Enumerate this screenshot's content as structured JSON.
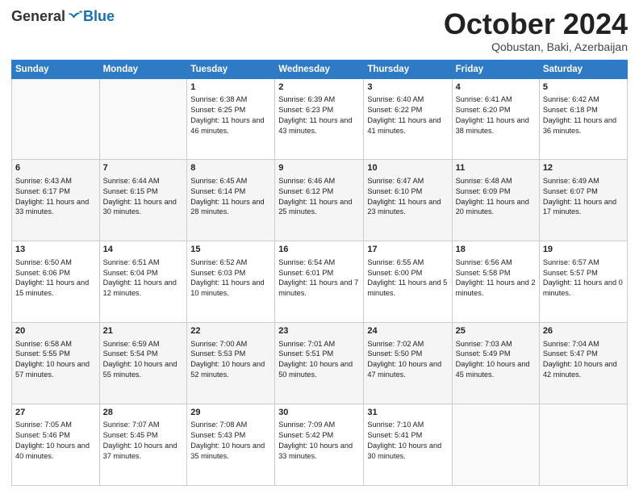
{
  "logo": {
    "general": "General",
    "blue": "Blue"
  },
  "title": "October 2024",
  "subtitle": "Qobustan, Baki, Azerbaijan",
  "headers": [
    "Sunday",
    "Monday",
    "Tuesday",
    "Wednesday",
    "Thursday",
    "Friday",
    "Saturday"
  ],
  "weeks": [
    [
      {
        "day": "",
        "sunrise": "",
        "sunset": "",
        "daylight": ""
      },
      {
        "day": "",
        "sunrise": "",
        "sunset": "",
        "daylight": ""
      },
      {
        "day": "1",
        "sunrise": "Sunrise: 6:38 AM",
        "sunset": "Sunset: 6:25 PM",
        "daylight": "Daylight: 11 hours and 46 minutes."
      },
      {
        "day": "2",
        "sunrise": "Sunrise: 6:39 AM",
        "sunset": "Sunset: 6:23 PM",
        "daylight": "Daylight: 11 hours and 43 minutes."
      },
      {
        "day": "3",
        "sunrise": "Sunrise: 6:40 AM",
        "sunset": "Sunset: 6:22 PM",
        "daylight": "Daylight: 11 hours and 41 minutes."
      },
      {
        "day": "4",
        "sunrise": "Sunrise: 6:41 AM",
        "sunset": "Sunset: 6:20 PM",
        "daylight": "Daylight: 11 hours and 38 minutes."
      },
      {
        "day": "5",
        "sunrise": "Sunrise: 6:42 AM",
        "sunset": "Sunset: 6:18 PM",
        "daylight": "Daylight: 11 hours and 36 minutes."
      }
    ],
    [
      {
        "day": "6",
        "sunrise": "Sunrise: 6:43 AM",
        "sunset": "Sunset: 6:17 PM",
        "daylight": "Daylight: 11 hours and 33 minutes."
      },
      {
        "day": "7",
        "sunrise": "Sunrise: 6:44 AM",
        "sunset": "Sunset: 6:15 PM",
        "daylight": "Daylight: 11 hours and 30 minutes."
      },
      {
        "day": "8",
        "sunrise": "Sunrise: 6:45 AM",
        "sunset": "Sunset: 6:14 PM",
        "daylight": "Daylight: 11 hours and 28 minutes."
      },
      {
        "day": "9",
        "sunrise": "Sunrise: 6:46 AM",
        "sunset": "Sunset: 6:12 PM",
        "daylight": "Daylight: 11 hours and 25 minutes."
      },
      {
        "day": "10",
        "sunrise": "Sunrise: 6:47 AM",
        "sunset": "Sunset: 6:10 PM",
        "daylight": "Daylight: 11 hours and 23 minutes."
      },
      {
        "day": "11",
        "sunrise": "Sunrise: 6:48 AM",
        "sunset": "Sunset: 6:09 PM",
        "daylight": "Daylight: 11 hours and 20 minutes."
      },
      {
        "day": "12",
        "sunrise": "Sunrise: 6:49 AM",
        "sunset": "Sunset: 6:07 PM",
        "daylight": "Daylight: 11 hours and 17 minutes."
      }
    ],
    [
      {
        "day": "13",
        "sunrise": "Sunrise: 6:50 AM",
        "sunset": "Sunset: 6:06 PM",
        "daylight": "Daylight: 11 hours and 15 minutes."
      },
      {
        "day": "14",
        "sunrise": "Sunrise: 6:51 AM",
        "sunset": "Sunset: 6:04 PM",
        "daylight": "Daylight: 11 hours and 12 minutes."
      },
      {
        "day": "15",
        "sunrise": "Sunrise: 6:52 AM",
        "sunset": "Sunset: 6:03 PM",
        "daylight": "Daylight: 11 hours and 10 minutes."
      },
      {
        "day": "16",
        "sunrise": "Sunrise: 6:54 AM",
        "sunset": "Sunset: 6:01 PM",
        "daylight": "Daylight: 11 hours and 7 minutes."
      },
      {
        "day": "17",
        "sunrise": "Sunrise: 6:55 AM",
        "sunset": "Sunset: 6:00 PM",
        "daylight": "Daylight: 11 hours and 5 minutes."
      },
      {
        "day": "18",
        "sunrise": "Sunrise: 6:56 AM",
        "sunset": "Sunset: 5:58 PM",
        "daylight": "Daylight: 11 hours and 2 minutes."
      },
      {
        "day": "19",
        "sunrise": "Sunrise: 6:57 AM",
        "sunset": "Sunset: 5:57 PM",
        "daylight": "Daylight: 11 hours and 0 minutes."
      }
    ],
    [
      {
        "day": "20",
        "sunrise": "Sunrise: 6:58 AM",
        "sunset": "Sunset: 5:55 PM",
        "daylight": "Daylight: 10 hours and 57 minutes."
      },
      {
        "day": "21",
        "sunrise": "Sunrise: 6:59 AM",
        "sunset": "Sunset: 5:54 PM",
        "daylight": "Daylight: 10 hours and 55 minutes."
      },
      {
        "day": "22",
        "sunrise": "Sunrise: 7:00 AM",
        "sunset": "Sunset: 5:53 PM",
        "daylight": "Daylight: 10 hours and 52 minutes."
      },
      {
        "day": "23",
        "sunrise": "Sunrise: 7:01 AM",
        "sunset": "Sunset: 5:51 PM",
        "daylight": "Daylight: 10 hours and 50 minutes."
      },
      {
        "day": "24",
        "sunrise": "Sunrise: 7:02 AM",
        "sunset": "Sunset: 5:50 PM",
        "daylight": "Daylight: 10 hours and 47 minutes."
      },
      {
        "day": "25",
        "sunrise": "Sunrise: 7:03 AM",
        "sunset": "Sunset: 5:49 PM",
        "daylight": "Daylight: 10 hours and 45 minutes."
      },
      {
        "day": "26",
        "sunrise": "Sunrise: 7:04 AM",
        "sunset": "Sunset: 5:47 PM",
        "daylight": "Daylight: 10 hours and 42 minutes."
      }
    ],
    [
      {
        "day": "27",
        "sunrise": "Sunrise: 7:05 AM",
        "sunset": "Sunset: 5:46 PM",
        "daylight": "Daylight: 10 hours and 40 minutes."
      },
      {
        "day": "28",
        "sunrise": "Sunrise: 7:07 AM",
        "sunset": "Sunset: 5:45 PM",
        "daylight": "Daylight: 10 hours and 37 minutes."
      },
      {
        "day": "29",
        "sunrise": "Sunrise: 7:08 AM",
        "sunset": "Sunset: 5:43 PM",
        "daylight": "Daylight: 10 hours and 35 minutes."
      },
      {
        "day": "30",
        "sunrise": "Sunrise: 7:09 AM",
        "sunset": "Sunset: 5:42 PM",
        "daylight": "Daylight: 10 hours and 33 minutes."
      },
      {
        "day": "31",
        "sunrise": "Sunrise: 7:10 AM",
        "sunset": "Sunset: 5:41 PM",
        "daylight": "Daylight: 10 hours and 30 minutes."
      },
      {
        "day": "",
        "sunrise": "",
        "sunset": "",
        "daylight": ""
      },
      {
        "day": "",
        "sunrise": "",
        "sunset": "",
        "daylight": ""
      }
    ]
  ]
}
